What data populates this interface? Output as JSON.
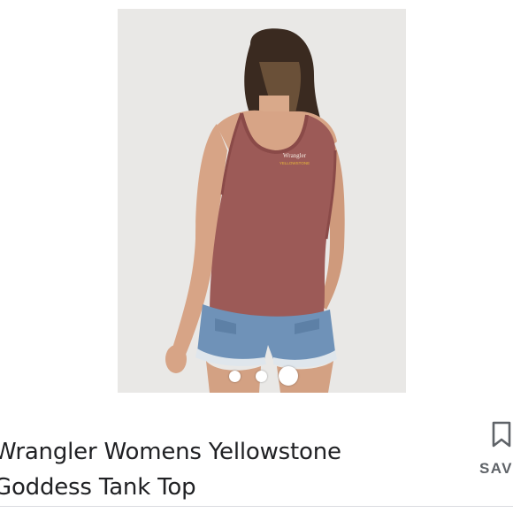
{
  "product": {
    "title_line1": "Wrangler Womens Yellowstone",
    "title_line2": "Goddess Tank Top",
    "image": {
      "alt": "Woman wearing rust-colored Wrangler Yellowstone tank top, back view, with denim shorts",
      "print_brand": "Wrangler",
      "print_sub": "YELLOWSTONE"
    }
  },
  "carousel": {
    "dot_count": 3,
    "active_index": 3
  },
  "actions": {
    "save_label": "SAV",
    "save_icon": "bookmark-icon"
  },
  "colors": {
    "background": "#ffffff",
    "image_bg": "#e9e8e6",
    "text": "#202124",
    "secondary_text": "#5f6368"
  }
}
